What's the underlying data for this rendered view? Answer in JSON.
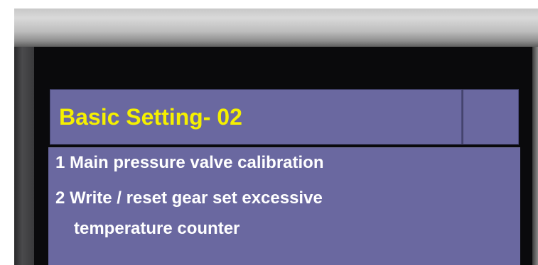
{
  "screen": {
    "title": "Basic Setting- 02",
    "items": [
      {
        "label": "1 Main pressure valve calibration"
      },
      {
        "label": "2 Write / reset gear set excessive"
      },
      {
        "label": "temperature counter"
      }
    ]
  },
  "colors": {
    "panel": "#6a68a0",
    "title_text": "#f5f000",
    "item_text": "#ffffff",
    "screen_bg": "#0a0a0c"
  }
}
